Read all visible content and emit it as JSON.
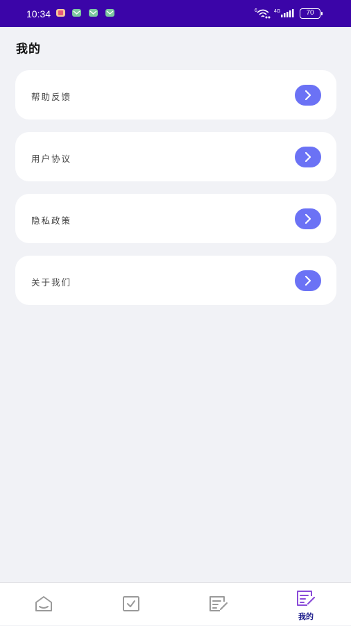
{
  "status_bar": {
    "time": "10:34",
    "battery": "70",
    "network": "4G",
    "icons": [
      "notification-app-icon",
      "message-icon",
      "message-icon",
      "message-icon",
      "wifi-icon",
      "signal-icon",
      "battery-icon"
    ]
  },
  "page": {
    "title": "我的"
  },
  "menu": {
    "items": [
      {
        "label": "帮助反馈",
        "icon": "chevron-right-icon"
      },
      {
        "label": "用户协议",
        "icon": "chevron-right-icon"
      },
      {
        "label": "隐私政策",
        "icon": "chevron-right-icon"
      },
      {
        "label": "关于我们",
        "icon": "chevron-right-icon"
      }
    ]
  },
  "tab_bar": {
    "tabs": [
      {
        "icon": "inbox-icon",
        "label": ""
      },
      {
        "icon": "checkbox-icon",
        "label": ""
      },
      {
        "icon": "edit-note-icon",
        "label": ""
      },
      {
        "icon": "edit-note-icon",
        "label": "我的",
        "active": true
      }
    ]
  },
  "colors": {
    "status_bar": "#3b05a8",
    "background": "#f1f2f6",
    "accent": "#6b72f5",
    "active_tab_icon": "#8a4bd8",
    "inactive_tab_icon": "#9a9a9a"
  }
}
